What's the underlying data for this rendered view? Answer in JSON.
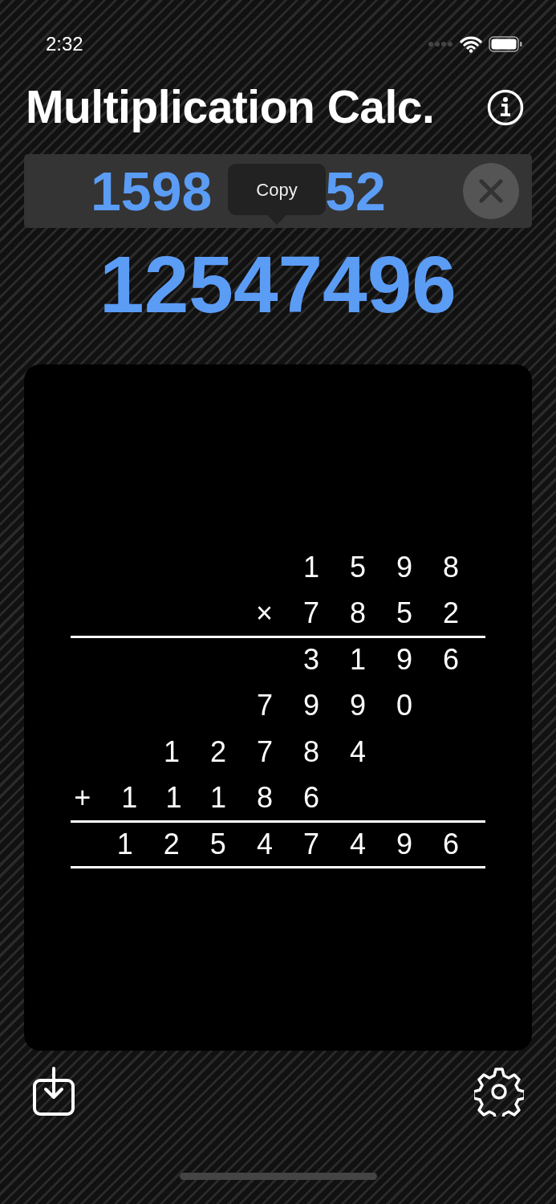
{
  "status_bar": {
    "time": "2:32"
  },
  "title": "Multiplication Calc.",
  "input": {
    "visible_text": [
      "1598",
      "52"
    ]
  },
  "copy_popover": {
    "label": "Copy"
  },
  "answer": "12547496",
  "working": {
    "multiplicand": "1598",
    "multiplier": {
      "operator": "×",
      "digits": "7852"
    },
    "partial_products": [
      {
        "digits": "3196"
      },
      {
        "digits": "7990"
      },
      {
        "digits": "12784"
      },
      {
        "operator": "+",
        "digits": "11186"
      }
    ],
    "result": "12547496"
  }
}
